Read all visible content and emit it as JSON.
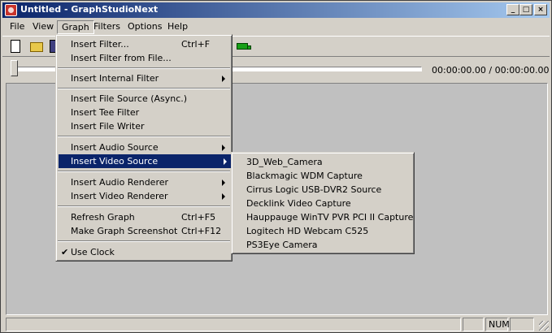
{
  "window": {
    "title": "Untitled - GraphStudioNext",
    "controls": {
      "minimize": "_",
      "maximize": "□",
      "close": "×"
    }
  },
  "menubar": {
    "items": [
      {
        "label": "File"
      },
      {
        "label": "View"
      },
      {
        "label": "Graph"
      },
      {
        "label": "Filters"
      },
      {
        "label": "Options"
      },
      {
        "label": "Help"
      }
    ]
  },
  "toolbar": {
    "icons": [
      "new-file-icon",
      "open-folder-icon",
      "save-icon",
      "connect-icon"
    ]
  },
  "seekbar": {
    "position": 0,
    "time_text": "00:00:00.00 / 00:00:00.00"
  },
  "graph_menu": {
    "items": [
      {
        "label": "Insert Filter...",
        "shortcut": "Ctrl+F"
      },
      {
        "label": "Insert Filter from File..."
      },
      {
        "label": "Insert Internal Filter"
      },
      {
        "label": "Insert File Source (Async.)"
      },
      {
        "label": "Insert Tee Filter"
      },
      {
        "label": "Insert File Writer"
      },
      {
        "label": "Insert Audio Source"
      },
      {
        "label": "Insert Video Source"
      },
      {
        "label": "Insert Audio Renderer"
      },
      {
        "label": "Insert Video Renderer"
      },
      {
        "label": "Refresh Graph",
        "shortcut": "Ctrl+F5"
      },
      {
        "label": "Make Graph Screenshot",
        "shortcut": "Ctrl+F12"
      },
      {
        "label": "Use Clock"
      }
    ]
  },
  "video_source_menu": {
    "items": [
      {
        "label": "3D_Web_Camera"
      },
      {
        "label": "Blackmagic WDM Capture"
      },
      {
        "label": "Cirrus Logic USB-DVR2 Source"
      },
      {
        "label": "Decklink Video Capture"
      },
      {
        "label": "Hauppauge WinTV PVR PCI II Capture"
      },
      {
        "label": "Logitech HD Webcam C525"
      },
      {
        "label": "PS3Eye Camera"
      }
    ]
  },
  "statusbar": {
    "num": "NUM"
  },
  "colors": {
    "face": "#d4d0c8",
    "highlight": "#0a246a",
    "titlebar_start": "#0a246a",
    "titlebar_end": "#a6caf0"
  }
}
